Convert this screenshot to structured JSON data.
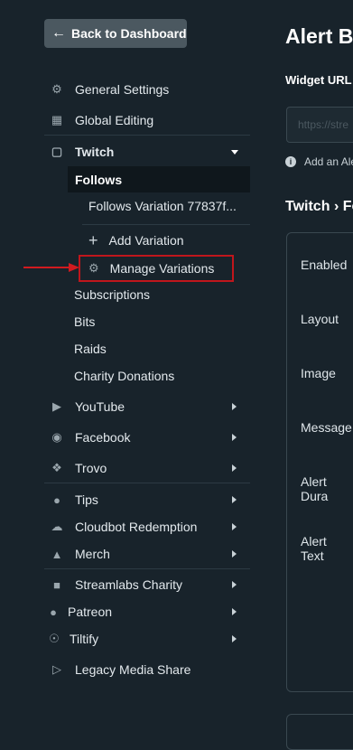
{
  "back_button": {
    "label": "Back to Dashboard"
  },
  "sidebar": {
    "general_settings": "General Settings",
    "global_editing": "Global Editing",
    "twitch": "Twitch",
    "follows": "Follows",
    "follows_variation": "Follows Variation 77837f...",
    "add_variation": "Add Variation",
    "manage_variations": "Manage Variations",
    "subscriptions": "Subscriptions",
    "bits": "Bits",
    "raids": "Raids",
    "charity_donations": "Charity Donations",
    "youtube": "YouTube",
    "facebook": "Facebook",
    "trovo": "Trovo",
    "tips": "Tips",
    "cloudbot_redemption": "Cloudbot Redemption",
    "merch": "Merch",
    "streamlabs_charity": "Streamlabs Charity",
    "patreon": "Patreon",
    "tiltify": "Tiltify",
    "legacy_media_share": "Legacy Media Share"
  },
  "main": {
    "title": "Alert B",
    "widget_url_label": "Widget URL",
    "widget_url_value": "https://stre",
    "info_text": "Add an Ale",
    "breadcrumb_root": "Twitch",
    "breadcrumb_sep": "›",
    "breadcrumb_current": "Fo",
    "fields": {
      "enabled": "Enabled",
      "layout": "Layout",
      "image": "Image",
      "message": "Message",
      "alert_duration": "Alert Dura",
      "alert_text": "Alert Text"
    }
  },
  "colors": {
    "background": "#18232b",
    "highlight_border": "#c0161c",
    "back_button_bg": "#4b5860"
  }
}
